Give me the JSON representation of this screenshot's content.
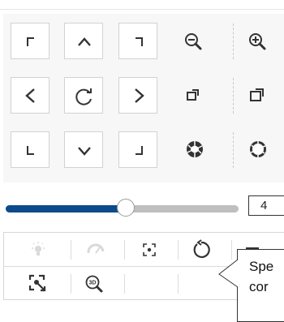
{
  "ptz_controls": {
    "direction_pad": [
      "up-left",
      "up",
      "up-right",
      "left",
      "auto-rotate",
      "right",
      "down-left",
      "down",
      "down-right"
    ],
    "zoom": [
      "zoom-out",
      "zoom-in"
    ],
    "focus": [
      "focus-near",
      "focus-far"
    ],
    "iris": [
      "iris-close",
      "iris-open"
    ]
  },
  "speed": {
    "value": "4",
    "level_fraction": 0.53
  },
  "tool_row1": [
    "light",
    "wiper",
    "manual-focus",
    "lens-reset",
    "menu"
  ],
  "tool_row2": [
    "regional-focus",
    "3d-zoom"
  ],
  "tooltip": {
    "line1": "Spe",
    "line2": "cor"
  },
  "colors": {
    "accent": "#0c4a8a",
    "icon": "#333333",
    "disabled_icon": "#d9d9d9"
  }
}
